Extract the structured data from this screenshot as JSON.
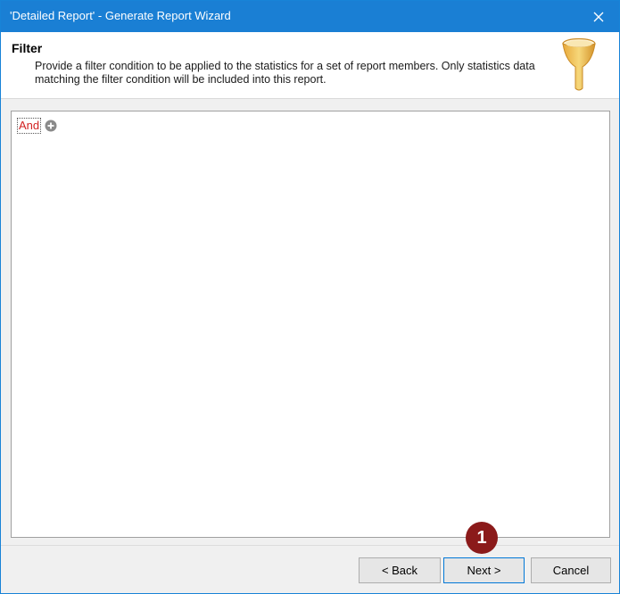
{
  "window": {
    "title": "'Detailed Report' - Generate Report Wizard",
    "accent_color": "#1a7fd4"
  },
  "header": {
    "title": "Filter",
    "description": "Provide a filter condition to be applied to the statistics for a set of report members. Only statistics data matching the filter condition will be included into this report.",
    "icon": "funnel-icon"
  },
  "filter": {
    "root_operator": "And",
    "operator_color": "#d22222",
    "add_icon": "add-condition-icon"
  },
  "buttons": {
    "back_label": "< Back",
    "next_label": "Next >",
    "cancel_label": "Cancel"
  },
  "annotation": {
    "step_number": "1",
    "badge_color": "#8b1a1a"
  }
}
